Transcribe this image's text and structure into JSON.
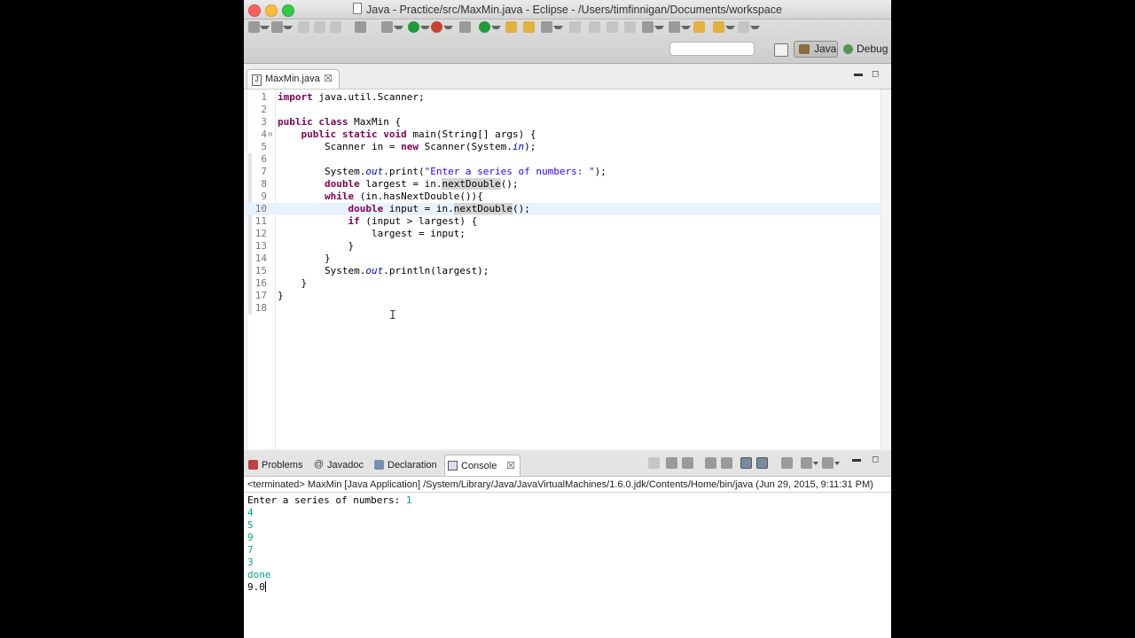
{
  "window": {
    "title": "Java - Practice/src/MaxMin.java - Eclipse - /Users/timfinnigan/Documents/workspace"
  },
  "toolbar": {
    "quick_access_placeholder": "",
    "perspectives": [
      {
        "label": "Java",
        "active": true,
        "icon": "java-perspective-icon"
      },
      {
        "label": "Debug",
        "active": false,
        "icon": "debug-perspective-icon"
      }
    ]
  },
  "editor": {
    "tab": {
      "label": "MaxMin.java",
      "icon": "java-file-icon"
    },
    "current_line": 10,
    "lines": [
      {
        "n": "1"
      },
      {
        "n": "2"
      },
      {
        "n": "3"
      },
      {
        "n": "4"
      },
      {
        "n": "5"
      },
      {
        "n": "6"
      },
      {
        "n": "7"
      },
      {
        "n": "8"
      },
      {
        "n": "9"
      },
      {
        "n": "10"
      },
      {
        "n": "11"
      },
      {
        "n": "12"
      },
      {
        "n": "13"
      },
      {
        "n": "14"
      },
      {
        "n": "15"
      },
      {
        "n": "16"
      },
      {
        "n": "17"
      },
      {
        "n": "18"
      }
    ],
    "code": {
      "l1": {
        "kw": "import",
        "rest": " java.util.Scanner;"
      },
      "l3": {
        "kw1": "public",
        "kw2": "class",
        "rest": " MaxMin {"
      },
      "l4": {
        "kw1": "public",
        "kw2": "static",
        "kw3": "void",
        "rest": " main(String[] args) {"
      },
      "l5": {
        "a": "Scanner in = ",
        "kw": "new",
        "b": " Scanner(System.",
        "it": "in",
        "c": ");"
      },
      "l7": {
        "a": "System.",
        "it": "out",
        "b": ".print(",
        "str": "\"Enter a series of numbers: \"",
        "c": ");"
      },
      "l8": {
        "kw": "double",
        "a": " largest = in.",
        "hl": "nextDouble",
        "b": "();"
      },
      "l9": {
        "kw": "while",
        "a": " (in.hasNextDouble()){"
      },
      "l10": {
        "kw": "double",
        "a": " input = in.",
        "hl": "nextDouble",
        "b": "();"
      },
      "l11": {
        "kw": "if",
        "a": " (input > largest) {"
      },
      "l12": {
        "a": "largest = input;"
      },
      "l13": {
        "a": "}"
      },
      "l14": {
        "a": "}"
      },
      "l15": {
        "a": "System.",
        "it": "out",
        "b": ".println(largest);"
      },
      "l16": {
        "a": "}"
      },
      "l17": {
        "a": "}"
      }
    }
  },
  "console": {
    "tabs": [
      {
        "label": "Problems",
        "icon": "problems-icon",
        "active": false
      },
      {
        "label": "Javadoc",
        "icon": "javadoc-icon",
        "active": false
      },
      {
        "label": "Declaration",
        "icon": "declaration-icon",
        "active": false
      },
      {
        "label": "Console",
        "icon": "console-icon",
        "active": true
      }
    ],
    "description": "<terminated> MaxMin [Java Application] /System/Library/Java/JavaVirtualMachines/1.6.0.jdk/Contents/Home/bin/java (Jun 29, 2015, 9:11:31 PM)",
    "prompt": "Enter a series of numbers: ",
    "inputs": [
      "1",
      "4",
      "5",
      "9",
      "7",
      "3",
      "done"
    ],
    "result": "9.0"
  }
}
